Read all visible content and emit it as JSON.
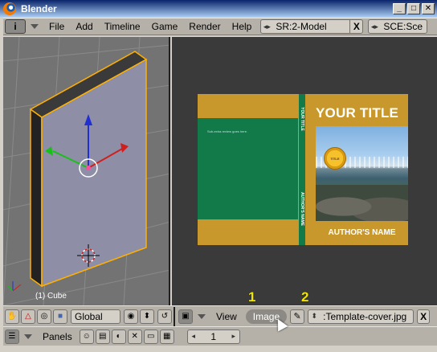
{
  "window": {
    "title": "Blender",
    "minimize": "_",
    "maximize": "□",
    "close": "✕"
  },
  "header": {
    "menus": [
      "File",
      "Add",
      "Timeline",
      "Game",
      "Render",
      "Help"
    ],
    "screen_field": "SR:2-Model",
    "scene_field": "SCE:Sce",
    "clear_x": "X"
  },
  "view3d": {
    "object_label": "(1) Cube"
  },
  "book_cover": {
    "front_title": "YOUR TITLE",
    "author": "AUTHOR'S NAME",
    "spine_title": "YOUR TITLE",
    "spine_author": "AUTHOR'S NAME",
    "seal_text": "TITLE",
    "back_blurb": "Sub-extra review goes here."
  },
  "view3d_header": {
    "orientation": "Global"
  },
  "image_header": {
    "view_menu": "View",
    "image_menu": "Image",
    "image_name": ":Template-cover.jpg",
    "clear_x": "X"
  },
  "bottom_header": {
    "panels_label": "Panels",
    "page_number": "1"
  },
  "annotations": [
    "1",
    "2"
  ],
  "colors": {
    "accent_gold": "#c9982d",
    "cover_green": "#127a48",
    "annotation_yellow": "#f0e600"
  }
}
